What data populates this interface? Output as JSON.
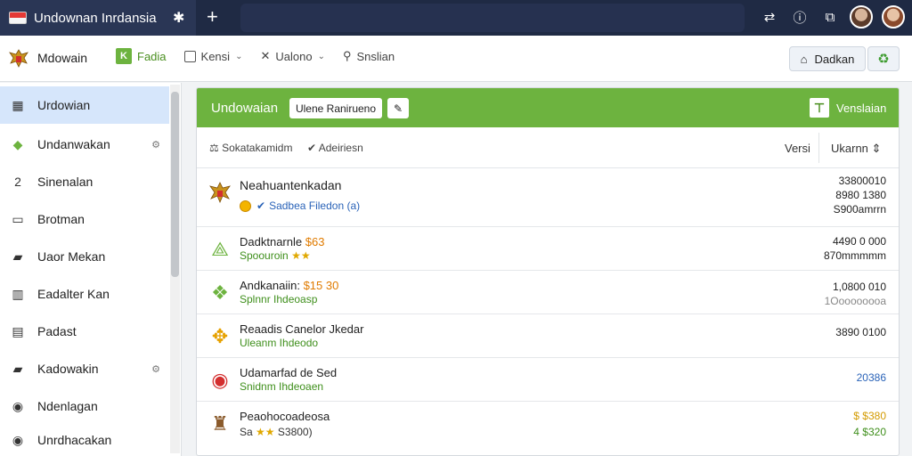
{
  "browser": {
    "tab_title": "Undownan Inrdansia",
    "new_tab": "+"
  },
  "appbar": {
    "app_name": "Mdowain",
    "menu": [
      {
        "label": "Fadia",
        "badge": "K"
      },
      {
        "label": "Kensi"
      },
      {
        "label": "Ualono"
      },
      {
        "label": "Snslian"
      }
    ],
    "login_label": "Dadkan"
  },
  "sidebar": {
    "items": [
      {
        "label": "Urdowian",
        "icon": "grid-icon",
        "glyph": "▦"
      },
      {
        "label": "Undanwakan",
        "icon": "tag-icon",
        "glyph": "◆"
      },
      {
        "label": "Sinenalan",
        "icon": "number-icon",
        "glyph": "2"
      },
      {
        "label": "Brotman",
        "icon": "window-icon",
        "glyph": "▭"
      },
      {
        "label": "Uaor Mekan",
        "icon": "folder-icon",
        "glyph": "▰"
      },
      {
        "label": "Eadalter Kan",
        "icon": "building-icon",
        "glyph": "▥"
      },
      {
        "label": "Padast",
        "icon": "chart-icon",
        "glyph": "▤"
      },
      {
        "label": "Kadowakin",
        "icon": "folder-icon",
        "glyph": "▰"
      },
      {
        "label": "Ndenlagan",
        "icon": "circle-icon",
        "glyph": "◉"
      },
      {
        "label": "Unrdhacakan",
        "icon": "circle-icon",
        "glyph": "◉"
      }
    ]
  },
  "panel": {
    "title": "Undowaian",
    "head_button": "Ulene Ranirueno",
    "head_right": "Venslaian",
    "toolbar_a": "Sokatakamidm",
    "toolbar_b": "Adeiriesn",
    "col_versi": "Versi",
    "col_ukuran": "Ukarnn",
    "rows": [
      {
        "title": "Neahuantenkadan",
        "sub_link": "Sadbea Filedon (a)",
        "sizes": [
          "33800010",
          "8980 1380",
          "S900amrrn"
        ]
      },
      {
        "title": "Dadktnarnle",
        "price": "$63",
        "sub": "Spoouroin",
        "stars": "★★",
        "sizes": [
          "4490 0 000",
          "870mmmmm"
        ]
      },
      {
        "title": "Andkanaiin:",
        "price": "$15 30",
        "sub": "Splnnr Ihdeoasp",
        "sizes": [
          "1,0800 010",
          "1Ooooooooa"
        ]
      },
      {
        "title": "Reaadis Canelor Jkedar",
        "sub": "Uleanm Ihdeodo",
        "sizes": [
          "3890 0100"
        ]
      },
      {
        "title": "Udamarfad de Sed",
        "sub": "Snidnm Ihdeoaen",
        "sizes": [
          "20386"
        ]
      },
      {
        "title": "Peaohocoadeosa",
        "sub_prefix": "Sa",
        "stars": "★★",
        "sub_suffix": "S3800)",
        "sizes": [
          "$ $380",
          "4 $320"
        ]
      }
    ]
  }
}
